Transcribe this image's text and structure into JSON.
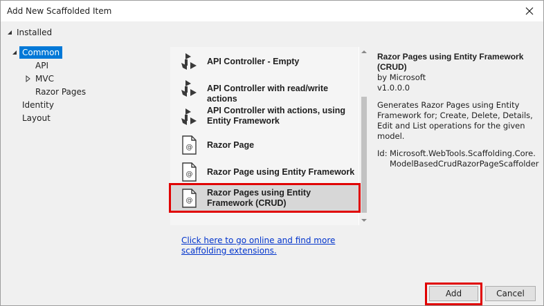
{
  "window": {
    "title": "Add New Scaffolded Item"
  },
  "sidebar": {
    "root_label": "Installed",
    "items": [
      {
        "label": "Common",
        "selected": true
      },
      {
        "label": "API"
      },
      {
        "label": "MVC"
      },
      {
        "label": "Razor Pages"
      },
      {
        "label": "Identity"
      },
      {
        "label": "Layout"
      }
    ]
  },
  "templates": [
    {
      "label": "API Controller - Empty",
      "icon": "api-controller-icon"
    },
    {
      "label": "API Controller with read/write actions",
      "icon": "api-controller-icon"
    },
    {
      "label": "API Controller with actions, using Entity Framework",
      "icon": "api-controller-icon"
    },
    {
      "label": "Razor Page",
      "icon": "razor-page-icon"
    },
    {
      "label": "Razor Page using Entity Framework",
      "icon": "razor-page-icon"
    },
    {
      "label": "Razor Pages using Entity Framework (CRUD)",
      "icon": "razor-page-icon",
      "selected": true
    }
  ],
  "details": {
    "title": "Razor Pages using Entity Framework (CRUD)",
    "author": "by Microsoft",
    "version": "v1.0.0.0",
    "description": "Generates Razor Pages using Entity Framework for; Create, Delete, Details, Edit and List operations for the given model.",
    "id_label": "Id:",
    "id_value": "Microsoft.WebTools.Scaffolding.Core.ModelBasedCrudRazorPageScaffolder"
  },
  "online_link": "Click here to go online and find more scaffolding extensions.",
  "buttons": {
    "add": "Add",
    "cancel": "Cancel"
  },
  "colors": {
    "selection": "#0078d7",
    "highlight": "#e00000",
    "link": "#0033cc"
  }
}
